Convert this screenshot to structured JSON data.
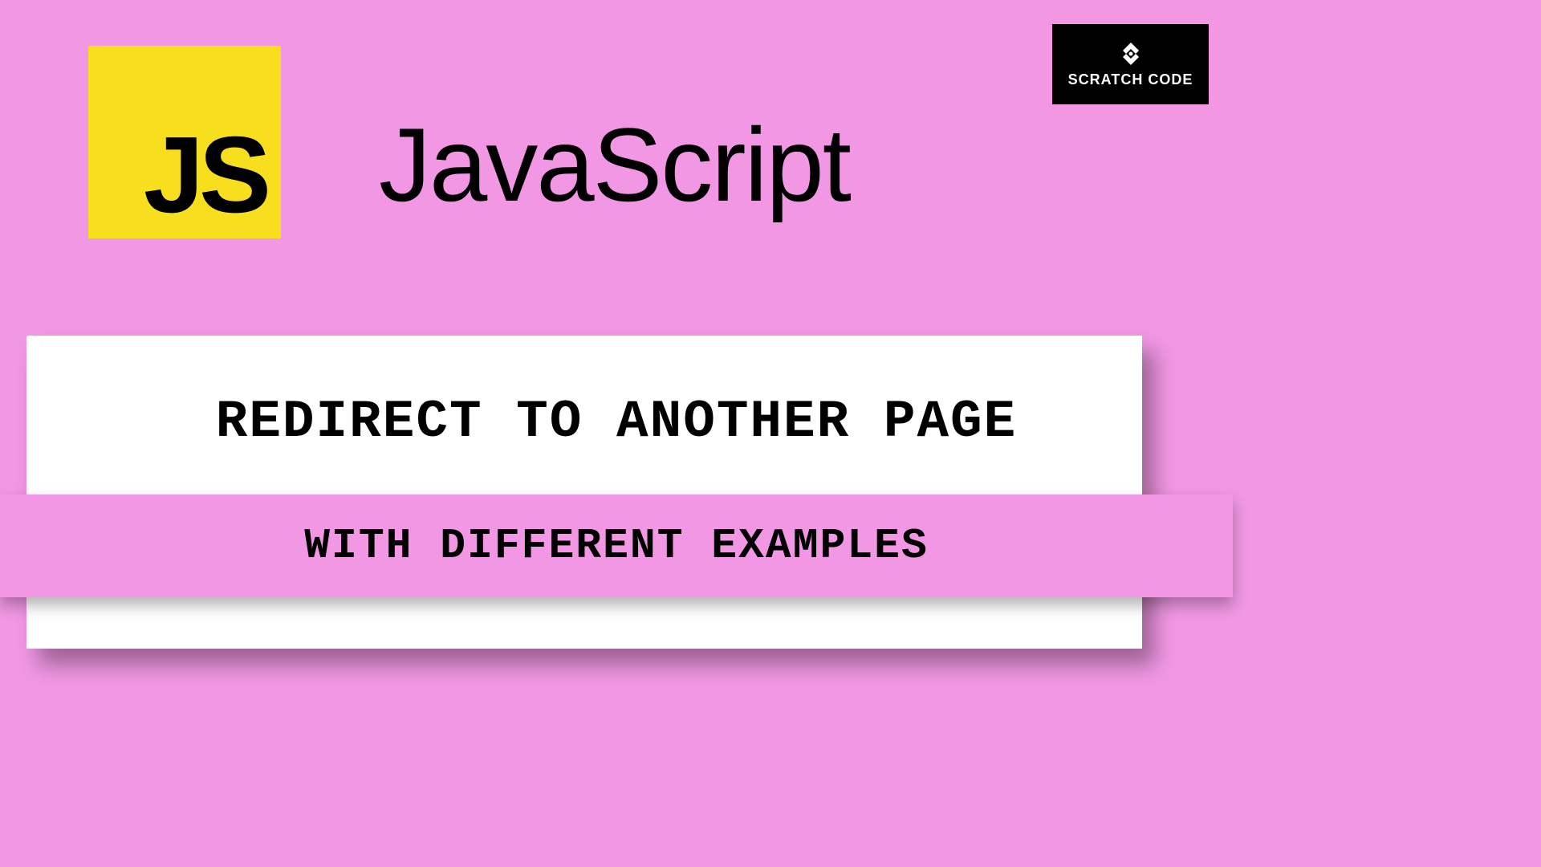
{
  "logo": {
    "text": "JS"
  },
  "title": "JavaScript",
  "badge": {
    "text": "SCRATCH CODE"
  },
  "main_text": "REDIRECT TO ANOTHER PAGE",
  "sub_text": "WITH DIFFERENT EXAMPLES",
  "colors": {
    "background": "#f197e4",
    "js_yellow": "#f7df1e",
    "badge_bg": "#000000"
  }
}
